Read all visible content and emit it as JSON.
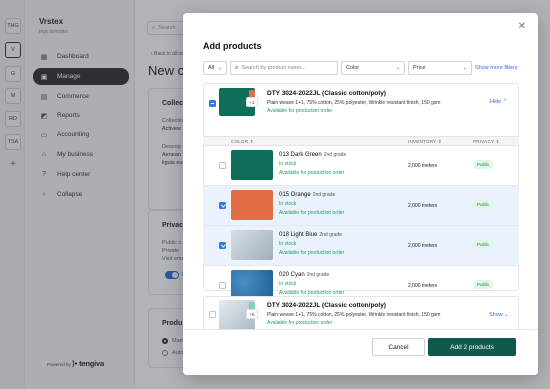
{
  "workspaces": [
    {
      "label": "THG"
    },
    {
      "label": "V"
    },
    {
      "label": "G"
    },
    {
      "label": "M"
    },
    {
      "label": "RD"
    },
    {
      "label": "TSA"
    },
    {
      "label": "+"
    }
  ],
  "sidebar": {
    "brand": "Vrstex",
    "url": "tngv.io/vrstex",
    "items": [
      {
        "label": "Dashboard",
        "icon": "dashboard-icon",
        "glyph": "▦"
      },
      {
        "label": "Manage",
        "icon": "manage-icon",
        "glyph": "▣"
      },
      {
        "label": "Commerce",
        "icon": "commerce-icon",
        "glyph": "▤"
      },
      {
        "label": "Reports",
        "icon": "reports-icon",
        "glyph": "◩"
      },
      {
        "label": "Accounting",
        "icon": "accounting-icon",
        "glyph": "▭"
      },
      {
        "label": "My business",
        "icon": "business-icon",
        "glyph": "⌂"
      },
      {
        "label": "Help center",
        "icon": "help-icon",
        "glyph": "?"
      },
      {
        "label": "Collapse",
        "icon": "collapse-icon",
        "glyph": "‹"
      }
    ],
    "powered_by": "Powered by",
    "powered_brand": "tengiva"
  },
  "main": {
    "search_placeholder": "Search",
    "back_link": "‹ Back to all co",
    "title": "New co",
    "card1_title": "Collec",
    "card1_label": "Collection",
    "card1_value": "Activew",
    "card1_desc_label": "Descrip",
    "card1_desc_1": "Aenean",
    "card1_desc_2": "ligula eu",
    "card2_title": "Privac",
    "card2_line1": "Public c",
    "card2_line2": "Private",
    "card2_line3": "Visit ema",
    "card2_toggle": "P",
    "card3_title": "Produ",
    "card3_opt1": "Man",
    "card3_opt2": "Auto"
  },
  "modal": {
    "title": "Add products",
    "close_glyph": "✕",
    "filters": {
      "all": "All",
      "search_placeholder": "Search by product name...",
      "color": "Color",
      "price": "Price",
      "show_more": "Show more filters"
    },
    "table_headers": {
      "color": "COLOR ⇕",
      "inventory": "INVENTORY ⇕",
      "privacy": "PRIVACY ⇕"
    },
    "products": [
      {
        "name": "DTY 3024-2022JL (Classic cotton/poly)",
        "description": "Plain weave 1+1, 75% cotton, 25% polyester, Wrinkle resistant finish, 150 gsm",
        "availability": "Available for production order",
        "stack": "+1",
        "toggle_label": "Hide",
        "toggle_glyph": "⌃",
        "variants": [
          {
            "name": "013 Dark Green",
            "grade": "2nd grade",
            "stock": "In stock",
            "availability": "Available for production order",
            "inventory": "2,000 meters",
            "privacy": "Public",
            "selected": false,
            "color": "#0e6e5a"
          },
          {
            "name": "015 Orange",
            "grade": "2nd grade",
            "stock": "In stock",
            "availability": "Available for production order",
            "inventory": "2,000 meters",
            "privacy": "Public",
            "selected": true,
            "color": "#e27044"
          },
          {
            "name": "018 Light Blue",
            "grade": "2nd grade",
            "stock": "In stock",
            "availability": "Available for production order",
            "inventory": "2,000 meters",
            "privacy": "Public",
            "selected": true,
            "color": "#b9c5cf"
          },
          {
            "name": "020 Cyan",
            "grade": "2nd grade",
            "stock": "In stock",
            "availability": "Available for production order",
            "inventory": "2,000 meters",
            "privacy": "Public",
            "selected": false,
            "color": "#2a6fa8"
          }
        ]
      },
      {
        "name": "DTY 3024-2022JL (Classic cotton/poly)",
        "description": "Plain weave 1+1, 75% cotton, 25% polyester, Wrinkle resistant finish, 150 gsm",
        "availability": "Available for production order",
        "stack": "+5",
        "toggle_label": "Show",
        "toggle_glyph": "⌄"
      }
    ],
    "cancel_label": "Cancel",
    "add_label": "Add 2 products"
  },
  "colors": {
    "accent": "#0f5a4c",
    "link": "#2a6fe0",
    "checkbox": "#2f7ae5",
    "success": "#1f9e55"
  }
}
